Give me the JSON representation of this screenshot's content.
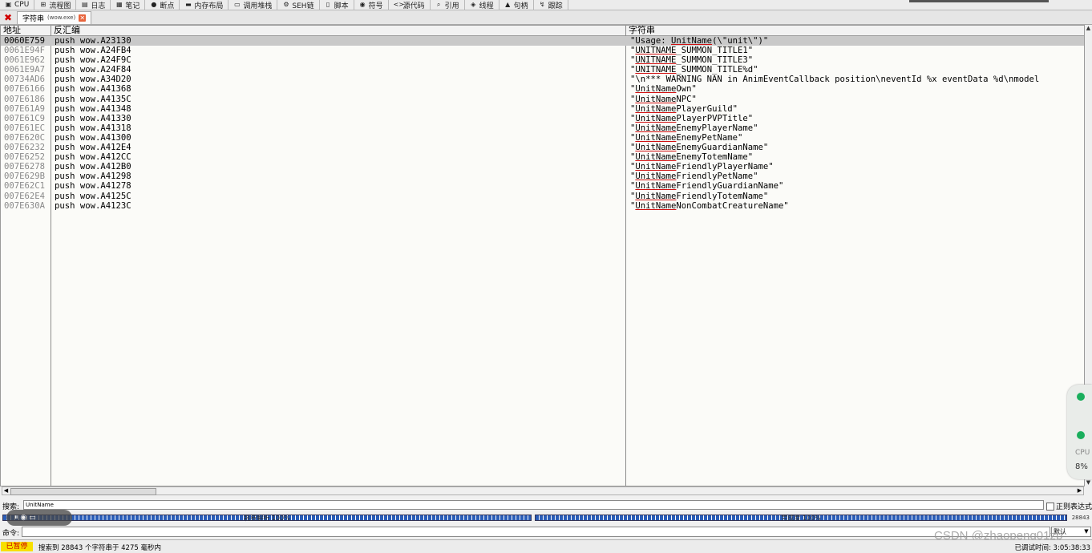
{
  "toolbar": {
    "tabs": [
      {
        "label": "CPU",
        "icon": "cpu-icon",
        "glyph": "▣"
      },
      {
        "label": "流程图",
        "icon": "graph-icon",
        "glyph": "⊞"
      },
      {
        "label": "日志",
        "icon": "log-icon",
        "glyph": "▤"
      },
      {
        "label": "笔记",
        "icon": "notes-icon",
        "glyph": "▦"
      },
      {
        "label": "断点",
        "icon": "breakpoint-icon",
        "glyph": "●"
      },
      {
        "label": "内存布局",
        "icon": "memory-map-icon",
        "glyph": "▬"
      },
      {
        "label": "调用堆栈",
        "icon": "call-stack-icon",
        "glyph": "▭"
      },
      {
        "label": "SEH链",
        "icon": "seh-icon",
        "glyph": "⚙"
      },
      {
        "label": "脚本",
        "icon": "script-icon",
        "glyph": "▯"
      },
      {
        "label": "符号",
        "icon": "symbols-icon",
        "glyph": "◉"
      },
      {
        "label": "源代码",
        "icon": "source-icon",
        "glyph": "<>"
      },
      {
        "label": "引用",
        "icon": "references-icon",
        "glyph": "⌕"
      },
      {
        "label": "线程",
        "icon": "threads-icon",
        "glyph": "◈"
      },
      {
        "label": "句柄",
        "icon": "handles-icon",
        "glyph": "▲"
      },
      {
        "label": "跟踪",
        "icon": "trace-icon",
        "glyph": "↯"
      }
    ]
  },
  "subtab": {
    "close_glyph": "✖",
    "title": "字符串",
    "subtitle": "(wow.exe)",
    "close_icon_glyph": "✕"
  },
  "table": {
    "headers": {
      "address": "地址",
      "disasm": "反汇编",
      "string": "字符串"
    },
    "rows": [
      {
        "addr": "0060E759",
        "dis": "push wow.A23130",
        "pre": "\"Usage: ",
        "hl": "UnitName",
        "post": "(\\\"unit\\\")\"",
        "selected": true
      },
      {
        "addr": "0061E94F",
        "dis": "push wow.A24FB4",
        "pre": "\"",
        "hl": "UNITNAME",
        "post": "_SUMMON_TITLE1\"",
        "selected": false
      },
      {
        "addr": "0061E962",
        "dis": "push wow.A24F9C",
        "pre": "\"",
        "hl": "UNITNAME",
        "post": "_SUMMON_TITLE3\"",
        "selected": false
      },
      {
        "addr": "0061E9A7",
        "dis": "push wow.A24F84",
        "pre": "\"",
        "hl": "UNITNAME",
        "post": "_SUMMON_TITLE%d\"",
        "selected": false
      },
      {
        "addr": "00734AD6",
        "dis": "push wow.A34D20",
        "pre": "\"\\n*** WARNING NAN in AnimEventCallback position\\neventId %x eventData %d\\nmodel",
        "hl": "",
        "post": "",
        "selected": false
      },
      {
        "addr": "007E6166",
        "dis": "push wow.A41368",
        "pre": "\"",
        "hl": "UnitName",
        "post": "Own\"",
        "selected": false
      },
      {
        "addr": "007E6186",
        "dis": "push wow.A4135C",
        "pre": "\"",
        "hl": "UnitName",
        "post": "NPC\"",
        "selected": false
      },
      {
        "addr": "007E61A9",
        "dis": "push wow.A41348",
        "pre": "\"",
        "hl": "UnitName",
        "post": "PlayerGuild\"",
        "selected": false
      },
      {
        "addr": "007E61C9",
        "dis": "push wow.A41330",
        "pre": "\"",
        "hl": "UnitName",
        "post": "PlayerPVPTitle\"",
        "selected": false
      },
      {
        "addr": "007E61EC",
        "dis": "push wow.A41318",
        "pre": "\"",
        "hl": "UnitName",
        "post": "EnemyPlayerName\"",
        "selected": false
      },
      {
        "addr": "007E620C",
        "dis": "push wow.A41300",
        "pre": "\"",
        "hl": "UnitName",
        "post": "EnemyPetName\"",
        "selected": false
      },
      {
        "addr": "007E6232",
        "dis": "push wow.A412E4",
        "pre": "\"",
        "hl": "UnitName",
        "post": "EnemyGuardianName\"",
        "selected": false
      },
      {
        "addr": "007E6252",
        "dis": "push wow.A412CC",
        "pre": "\"",
        "hl": "UnitName",
        "post": "EnemyTotemName\"",
        "selected": false
      },
      {
        "addr": "007E6278",
        "dis": "push wow.A412B0",
        "pre": "\"",
        "hl": "UnitName",
        "post": "FriendlyPlayerName\"",
        "selected": false
      },
      {
        "addr": "007E629B",
        "dis": "push wow.A41298",
        "pre": "\"",
        "hl": "UnitName",
        "post": "FriendlyPetName\"",
        "selected": false
      },
      {
        "addr": "007E62C1",
        "dis": "push wow.A41278",
        "pre": "\"",
        "hl": "UnitName",
        "post": "FriendlyGuardianName\"",
        "selected": false
      },
      {
        "addr": "007E62E4",
        "dis": "push wow.A4125C",
        "pre": "\"",
        "hl": "UnitName",
        "post": "FriendlyTotemName\"",
        "selected": false
      },
      {
        "addr": "007E630A",
        "dis": "push wow.A4123C",
        "pre": "\"",
        "hl": "UnitName",
        "post": "NonCombatCreatureName\"",
        "selected": false
      }
    ]
  },
  "search": {
    "label": "搜索:",
    "value": "UnitName",
    "regex_label": "正则表达式"
  },
  "progress": {
    "left_label": "耗费解析 100%",
    "right_label": "完成度 100%",
    "count": "28843",
    "left_fraction": 1.0,
    "right_fraction": 1.0
  },
  "command": {
    "label": "命令:",
    "mode": "默认"
  },
  "status": {
    "state": "已暂停",
    "message": "搜索到 28843 个字符串于 4275 毫秒内",
    "debug_time": "已调试时间: 3:05:38:33"
  },
  "widget": {
    "cpu_label": "CPU",
    "cpu_percent": "8%"
  },
  "watermark": "CSDN @zhaopeng01zp",
  "colors": {
    "selected_row": "#c9c9c9",
    "match_underline": "#d01010",
    "paused_bg": "#f7e000",
    "paused_text": "#d00000",
    "progress": "#2a5db8"
  }
}
